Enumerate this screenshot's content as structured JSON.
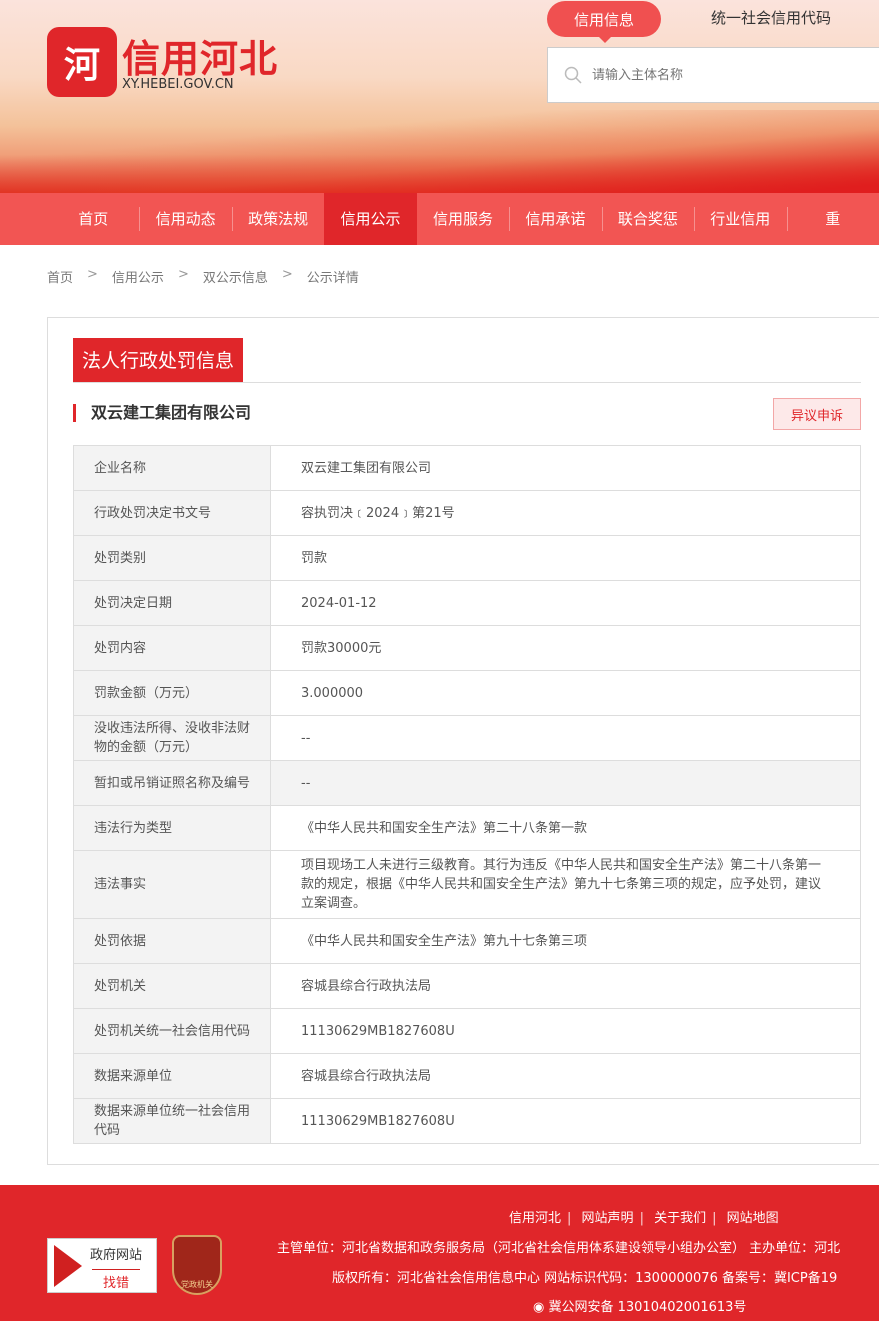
{
  "header": {
    "logo_mark": "河",
    "logo_title": "信用河北",
    "logo_url": "XY.HEBEI.GOV.CN",
    "tab_active": "信用信息",
    "tab_other": "统一社会信用代码",
    "search_placeholder": "请输入主体名称"
  },
  "nav": [
    "首页",
    "信用动态",
    "政策法规",
    "信用公示",
    "信用服务",
    "信用承诺",
    "联合奖惩",
    "行业信用",
    "重"
  ],
  "breadcrumb": [
    "首页",
    "信用公示",
    "双公示信息",
    "公示详情"
  ],
  "section_title": "法人行政处罚信息",
  "company": "双云建工集团有限公司",
  "appeal_button": "异议申诉",
  "rows": [
    {
      "k": "企业名称",
      "v": "双云建工集团有限公司"
    },
    {
      "k": "行政处罚决定书文号",
      "v": "容执罚决﹝2024﹞第21号"
    },
    {
      "k": "处罚类别",
      "v": "罚款"
    },
    {
      "k": "处罚决定日期",
      "v": "2024-01-12"
    },
    {
      "k": "处罚内容",
      "v": "罚款30000元"
    },
    {
      "k": "罚款金额（万元）",
      "v": "3.000000"
    },
    {
      "k": "没收违法所得、没收非法财物的金额（万元）",
      "v": "--"
    },
    {
      "k": "暂扣或吊销证照名称及编号",
      "v": "--"
    },
    {
      "k": "违法行为类型",
      "v": "《中华人民共和国安全生产法》第二十八条第一款"
    },
    {
      "k": "违法事实",
      "v": "项目现场工人未进行三级教育。其行为违反《中华人民共和国安全生产法》第二十八条第一款的规定，根据《中华人民共和国安全生产法》第九十七条第三项的规定，应予处罚，建议立案调查。"
    },
    {
      "k": "处罚依据",
      "v": "《中华人民共和国安全生产法》第九十七条第三项"
    },
    {
      "k": "处罚机关",
      "v": "容城县综合行政执法局"
    },
    {
      "k": "处罚机关统一社会信用代码",
      "v": "11130629MB1827608U"
    },
    {
      "k": "数据来源单位",
      "v": "容城县综合行政执法局"
    },
    {
      "k": "数据来源单位统一社会信用代码",
      "v": "11130629MB1827608U"
    }
  ],
  "footer": {
    "links": [
      "信用河北",
      "网站声明",
      "关于我们",
      "网站地图"
    ],
    "line1": "主管单位：河北省数据和政务服务局（河北省社会信用体系建设领导小组办公室）    主办单位：河北",
    "line2": "版权所有：河北省社会信用信息中心   网站标识代码：1300000076   备案号：冀ICP备19",
    "line3": "冀公网安备 13010402001613号",
    "badge1_top": "政府网站",
    "badge1_bottom": "找错",
    "badge2": "党政机关"
  }
}
